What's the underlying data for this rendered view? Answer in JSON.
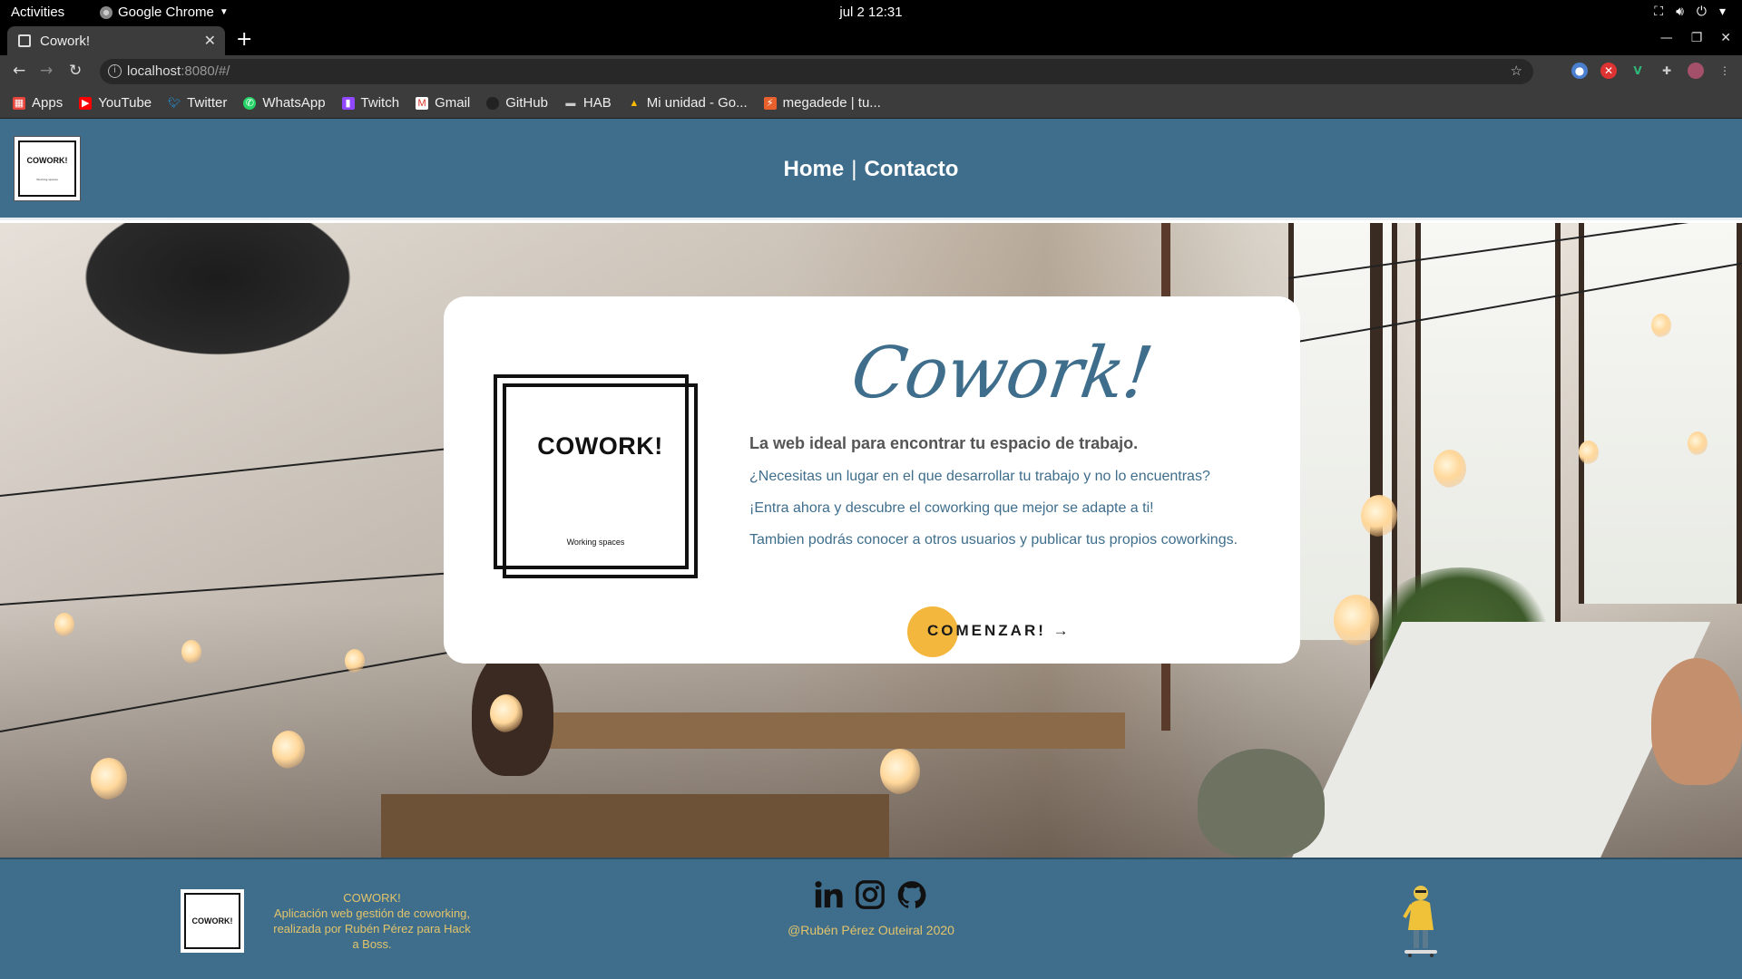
{
  "os": {
    "activities": "Activities",
    "app_name": "Google Chrome",
    "datetime": "jul 2  12:31"
  },
  "browser": {
    "tab_title": "Cowork!",
    "url_host": "localhost",
    "url_path": ":8080/#/",
    "bookmarks": [
      {
        "label": "Apps",
        "icon": "apps-grid-icon",
        "color": "#e8453c"
      },
      {
        "label": "YouTube",
        "icon": "youtube-icon",
        "color": "#ff0000"
      },
      {
        "label": "Twitter",
        "icon": "twitter-icon",
        "color": "#1da1f2"
      },
      {
        "label": "WhatsApp",
        "icon": "whatsapp-icon",
        "color": "#25d366"
      },
      {
        "label": "Twitch",
        "icon": "twitch-icon",
        "color": "#9146ff"
      },
      {
        "label": "Gmail",
        "icon": "gmail-icon",
        "color": "#d93025"
      },
      {
        "label": "GitHub",
        "icon": "github-icon",
        "color": "#222222"
      },
      {
        "label": "HAB",
        "icon": "folder-icon",
        "color": "#cccccc"
      },
      {
        "label": "Mi unidad - Go...",
        "icon": "google-drive-icon",
        "color": "#fbbc04"
      },
      {
        "label": "megadede | tu...",
        "icon": "megadede-icon",
        "color": "#e8602c"
      }
    ]
  },
  "header": {
    "logo_text": "COWORK!",
    "logo_sub": "Working spaces",
    "nav": {
      "home": "Home",
      "separator": "|",
      "contact": "Contacto"
    }
  },
  "hero": {
    "brand": "Cowork!",
    "logo_text": "COWORK!",
    "logo_sub": "Working spaces",
    "lead": "La web ideal para encontrar tu espacio de trabajo.",
    "lines": [
      "¿Necesitas un lugar en el que desarrollar tu trabajo y no lo encuentras?",
      "¡Entra ahora y descubre el coworking que mejor se adapte a ti!",
      "Tambien podrás conocer a otros usuarios y publicar tus propios coworkings."
    ],
    "cta": "COMENZAR! →"
  },
  "footer": {
    "logo_text": "COWORK!",
    "about_title": "COWORK!",
    "about_text": "Aplicación web gestión de coworking, realizada por Rubén Pérez para Hack a Boss.",
    "copyright": "@Rubén Pérez Outeiral 2020",
    "social": [
      "linkedin-icon",
      "instagram-icon",
      "github-icon"
    ]
  },
  "colors": {
    "primary": "#3f6e8c",
    "accent": "#f4b73e",
    "footer_text": "#e2c46b"
  }
}
